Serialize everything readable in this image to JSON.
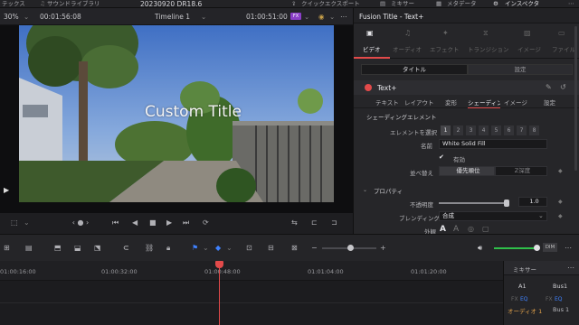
{
  "topbar": {
    "left_tab_1": "テックス",
    "left_tab_2": "サウンドライブラリ",
    "project_title": "20230920 DR18.6",
    "quick_export": "クイックエクスポート",
    "mixer_tab": "ミキサー",
    "metadata_tab": "メタデータ",
    "inspector_tab": "インスペクタ"
  },
  "viewer": {
    "zoom": "30%",
    "duration": "00:01:56:08",
    "timeline_name": "Timeline 1",
    "timecode": "01:00:51:00",
    "title_text": "Custom Title"
  },
  "inspector": {
    "panel_title": "Fusion Title - Text+",
    "media_tabs": [
      "ビデオ",
      "オーディオ",
      "エフェクト",
      "トランジション",
      "イメージ",
      "ファイル"
    ],
    "sub_tabs": [
      "タイトル",
      "設定"
    ],
    "effect_name": "Text+",
    "text_tabs": [
      "テキスト",
      "レイアウト",
      "変形",
      "シェーディング",
      "イメージ",
      "設定"
    ],
    "shading_section": "シェーディングエレメント",
    "select_element_label": "エレメントを選択",
    "element_numbers": [
      "1",
      "2",
      "3",
      "4",
      "5",
      "6",
      "7",
      "8"
    ],
    "name_label": "名前",
    "name_value": "White Solid Fill",
    "enabled_label": "有効",
    "sort_label": "並べ替え",
    "sort_options": [
      "優先順位",
      "Z深度"
    ],
    "properties_section": "プロパティ",
    "opacity_label": "不透明度",
    "opacity_value": "1.0",
    "opacity_level": 1.0,
    "blending_label": "ブレンディング",
    "blending_value": "合成",
    "appearance_label": "外観"
  },
  "timeline": {
    "ruler_labels": [
      "01:00:16:00",
      "01:00:32:00",
      "01:00:48:00",
      "01:01:04:00",
      "01:01:20:00"
    ],
    "dim_label": "DIM"
  },
  "mixer": {
    "title": "ミキサー",
    "channels": [
      "A1",
      "Bus1"
    ],
    "eq_labels": [
      "EQ",
      "EQ"
    ],
    "track_names": [
      "オーディオ 1",
      "Bus 1"
    ]
  },
  "colors": {
    "accent_red": "#e24a4a",
    "accent_blue": "#3f82ff",
    "panel_bg": "#262629"
  }
}
